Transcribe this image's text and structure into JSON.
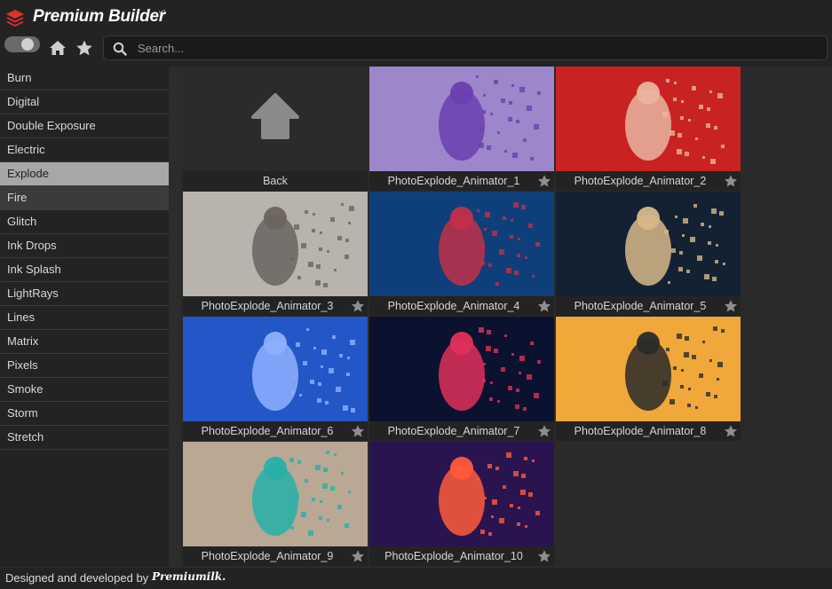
{
  "app": {
    "title": "Premium Builder",
    "version": "v2"
  },
  "toolbar": {
    "search_placeholder": "Search..."
  },
  "sidebar": {
    "items": [
      {
        "label": "Burn"
      },
      {
        "label": "Digital"
      },
      {
        "label": "Double Exposure"
      },
      {
        "label": "Electric"
      },
      {
        "label": "Explode",
        "state": "selected"
      },
      {
        "label": "Fire",
        "state": "hover"
      },
      {
        "label": "Glitch"
      },
      {
        "label": "Ink Drops"
      },
      {
        "label": "Ink Splash"
      },
      {
        "label": "LightRays"
      },
      {
        "label": "Lines"
      },
      {
        "label": "Matrix"
      },
      {
        "label": "Pixels"
      },
      {
        "label": "Smoke"
      },
      {
        "label": "Storm"
      },
      {
        "label": "Stretch"
      }
    ]
  },
  "grid": {
    "back_label": "Back",
    "items": [
      {
        "label": "PhotoExplode_Animator_1",
        "bg": "#9d86c9",
        "accent": "#6a3fb0"
      },
      {
        "label": "PhotoExplode_Animator_2",
        "bg": "#c92222",
        "accent": "#e8b5a0"
      },
      {
        "label": "PhotoExplode_Animator_3",
        "bg": "#b8b3ad",
        "accent": "#6a6460"
      },
      {
        "label": "PhotoExplode_Animator_4",
        "bg": "#0f3f7a",
        "accent": "#c23048"
      },
      {
        "label": "PhotoExplode_Animator_5",
        "bg": "#142133",
        "accent": "#d6b88a"
      },
      {
        "label": "PhotoExplode_Animator_6",
        "bg": "#2357c8",
        "accent": "#8fb0ff"
      },
      {
        "label": "PhotoExplode_Animator_7",
        "bg": "#0a1230",
        "accent": "#e0305a"
      },
      {
        "label": "PhotoExplode_Animator_8",
        "bg": "#f0a83a",
        "accent": "#2a2a2a"
      },
      {
        "label": "PhotoExplode_Animator_9",
        "bg": "#b8a894",
        "accent": "#26b0a8"
      },
      {
        "label": "PhotoExplode_Animator_10",
        "bg": "#2a1450",
        "accent": "#ff5a3a"
      }
    ]
  },
  "footer": {
    "text": "Designed and developed by",
    "brand": "Premiumilk."
  },
  "colors": {
    "selected": "#a7a7a7",
    "hover": "#3b3b3b",
    "background": "#232323"
  }
}
